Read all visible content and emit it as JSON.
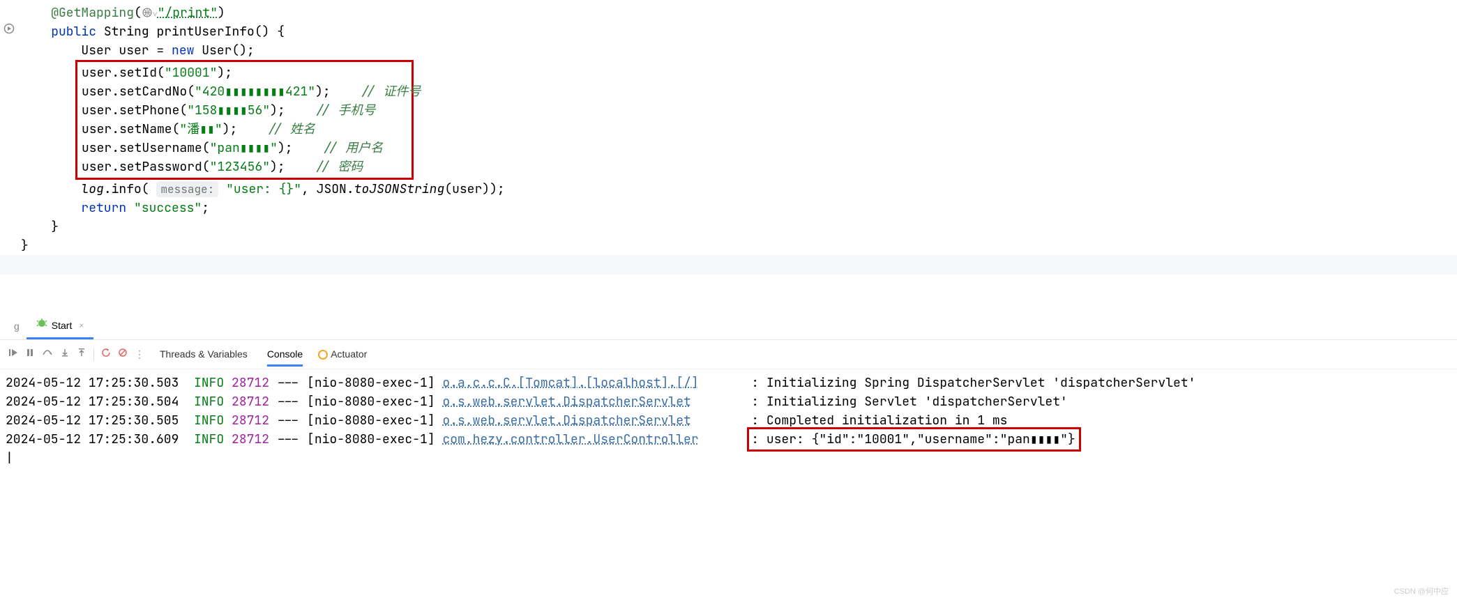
{
  "code": {
    "annotation": "@GetMapping",
    "route": "\"/print\"",
    "sig_public": "public",
    "sig_type": "String",
    "sig_name": "printUserInfo() {",
    "line_decl_pre": "User user = ",
    "line_decl_new": "new",
    "line_decl_post": " User();",
    "setId": "user.setId(",
    "setId_val": "\"10001\"",
    "setId_end": ");",
    "setCardNo": "user.setCardNo(",
    "setCardNo_val": "\"420▮▮▮▮▮▮▮▮421\"",
    "setCardNo_end": ");",
    "comment_card": "// 证件号",
    "setPhone": "user.setPhone(",
    "setPhone_val": "\"158▮▮▮▮56\"",
    "setPhone_end": ");",
    "comment_phone": "// 手机号",
    "setName": "user.setName(",
    "setName_val": "\"潘▮▮\"",
    "setName_end": ");",
    "comment_name": "// 姓名",
    "setUsername": "user.setUsername(",
    "setUsername_val": "\"pan▮▮▮▮\"",
    "setUsername_end": ");",
    "comment_user": "// 用户名",
    "setPassword": "user.setPassword(",
    "setPassword_val": "\"123456\"",
    "setPassword_end": ");",
    "comment_pwd": "// 密码",
    "log_pre": "log",
    "log_info": ".info(",
    "log_hint": "message:",
    "log_msg": "\"user: {}\"",
    "log_mid": ", JSON.",
    "log_toJson": "toJSONString",
    "log_post": "(user));",
    "return_kw": "return",
    "return_val": " \"success\"",
    "return_end": ";",
    "close1": "}",
    "close2": "}"
  },
  "runTab": {
    "label": "Start",
    "close": "×"
  },
  "toolbar": {
    "tv": "Threads & Variables",
    "console": "Console",
    "actuator": "Actuator"
  },
  "logs": [
    {
      "ts": "2024-05-12 17:25:30.503",
      "lvl": "INFO",
      "pid": "28712",
      "thread": " --- [nio-8080-exec-1] ",
      "src": "o.a.c.c.C.[Tomcat].[localhost].[/]",
      "msg": ": Initializing Spring DispatcherServlet 'dispatcherServlet'"
    },
    {
      "ts": "2024-05-12 17:25:30.504",
      "lvl": "INFO",
      "pid": "28712",
      "thread": " --- [nio-8080-exec-1] ",
      "src": "o.s.web.servlet.DispatcherServlet",
      "msg": ": Initializing Servlet 'dispatcherServlet'"
    },
    {
      "ts": "2024-05-12 17:25:30.505",
      "lvl": "INFO",
      "pid": "28712",
      "thread": " --- [nio-8080-exec-1] ",
      "src": "o.s.web.servlet.DispatcherServlet",
      "msg": ": Completed initialization in 1 ms"
    },
    {
      "ts": "2024-05-12 17:25:30.609",
      "lvl": "INFO",
      "pid": "28712",
      "thread": " --- [nio-8080-exec-1] ",
      "src": "com.hezy.controller.UserController",
      "msg": ": user: {\"id\":\"10001\",\"username\":\"pan▮▮▮▮\"}"
    }
  ],
  "watermark": "CSDN @何中应"
}
